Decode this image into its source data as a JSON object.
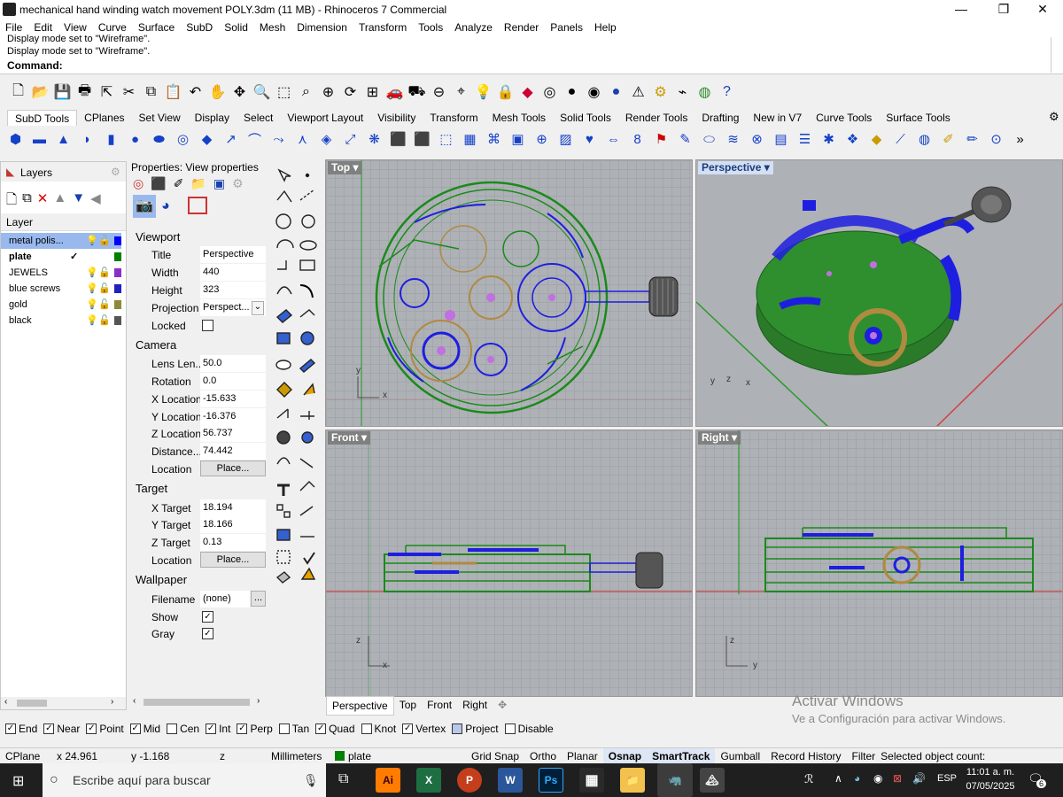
{
  "window": {
    "title": "mechanical hand winding watch movement POLY.3dm (11 MB) - Rhinoceros 7 Commercial"
  },
  "menu": [
    "File",
    "Edit",
    "View",
    "Curve",
    "Surface",
    "SubD",
    "Solid",
    "Mesh",
    "Dimension",
    "Transform",
    "Tools",
    "Analyze",
    "Render",
    "Panels",
    "Help"
  ],
  "command": {
    "history1": "Display mode set to \"Wireframe\".",
    "history2": "Display mode set to \"Wireframe\".",
    "prompt": "Command:"
  },
  "toolbar_tabs": [
    "SubD Tools",
    "CPlanes",
    "Set View",
    "Display",
    "Select",
    "Viewport Layout",
    "Visibility",
    "Transform",
    "Mesh Tools",
    "Solid Tools",
    "Render Tools",
    "Drafting",
    "New in V7",
    "Curve Tools",
    "Surface Tools"
  ],
  "layers": {
    "tab": "Layers",
    "column": "Layer",
    "items": [
      {
        "name": "metal polis...",
        "color": "#0000ff",
        "selected": true
      },
      {
        "name": "plate",
        "color": "#008000",
        "current": true,
        "mark": "✓"
      },
      {
        "name": "JEWELS",
        "color": "#8b2fc9"
      },
      {
        "name": "blue screws",
        "color": "#2020c0"
      },
      {
        "name": "gold",
        "color": "#8b8b3a"
      },
      {
        "name": "black",
        "color": "#555555"
      }
    ]
  },
  "properties": {
    "tab": "Properties: View properties",
    "viewport_section": "Viewport",
    "title_label": "Title",
    "title_value": "Perspective",
    "width_label": "Width",
    "width_value": "440",
    "height_label": "Height",
    "height_value": "323",
    "projection_label": "Projection",
    "projection_value": "Perspect...",
    "locked_label": "Locked",
    "camera_section": "Camera",
    "lens_label": "Lens Len...",
    "lens_value": "50.0",
    "rotation_label": "Rotation",
    "rotation_value": "0.0",
    "xloc_label": "X Location",
    "xloc_value": "-15.633",
    "yloc_label": "Y Location",
    "yloc_value": "-16.376",
    "zloc_label": "Z Location",
    "zloc_value": "56.737",
    "dist_label": "Distance...",
    "dist_value": "74.442",
    "loc_label": "Location",
    "place_button": "Place...",
    "target_section": "Target",
    "xt_label": "X Target",
    "xt_value": "18.194",
    "yt_label": "Y Target",
    "yt_value": "18.166",
    "zt_label": "Z Target",
    "zt_value": "0.13",
    "tloc_label": "Location",
    "tplace_button": "Place...",
    "wallpaper_section": "Wallpaper",
    "filename_label": "Filename",
    "filename_value": "(none)",
    "browse": "...",
    "show_label": "Show",
    "gray_label": "Gray"
  },
  "viewports": {
    "top": "Top",
    "perspective": "Perspective",
    "front": "Front",
    "right": "Right"
  },
  "viewport_tabs": [
    "Perspective",
    "Top",
    "Front",
    "Right"
  ],
  "osnaps": [
    {
      "label": "End",
      "on": true
    },
    {
      "label": "Near",
      "on": true
    },
    {
      "label": "Point",
      "on": true
    },
    {
      "label": "Mid",
      "on": true
    },
    {
      "label": "Cen",
      "on": false
    },
    {
      "label": "Int",
      "on": true
    },
    {
      "label": "Perp",
      "on": true
    },
    {
      "label": "Tan",
      "on": false
    },
    {
      "label": "Quad",
      "on": true
    },
    {
      "label": "Knot",
      "on": false
    },
    {
      "label": "Vertex",
      "on": true
    },
    {
      "label": "Project",
      "on": false
    },
    {
      "label": "Disable",
      "on": false
    }
  ],
  "status": {
    "cplane": "CPlane",
    "x": "x 24.961",
    "y": "y -1.168",
    "z": "z",
    "units": "Millimeters",
    "layer": "plate",
    "grid_snap": "Grid Snap",
    "ortho": "Ortho",
    "planar": "Planar",
    "osnap": "Osnap",
    "smarttrack": "SmartTrack",
    "gumball": "Gumball",
    "record_history": "Record History",
    "filter": "Filter",
    "selected": "Selected object count:"
  },
  "watermark": {
    "line1": "Activar Windows",
    "line2": "Ve a Configuración para activar Windows."
  },
  "taskbar": {
    "search_placeholder": "Escribe aquí para buscar",
    "time": "11:01 a. m.",
    "date": "07/05/2025",
    "lang": "ESP",
    "notif": "6"
  },
  "colors": {
    "wire_green": "#1a8a1a",
    "wire_blue": "#1e1ee0",
    "gold": "#b08a40",
    "viewport_bg": "#aeb1b6",
    "active_label": "#d2dff4"
  }
}
